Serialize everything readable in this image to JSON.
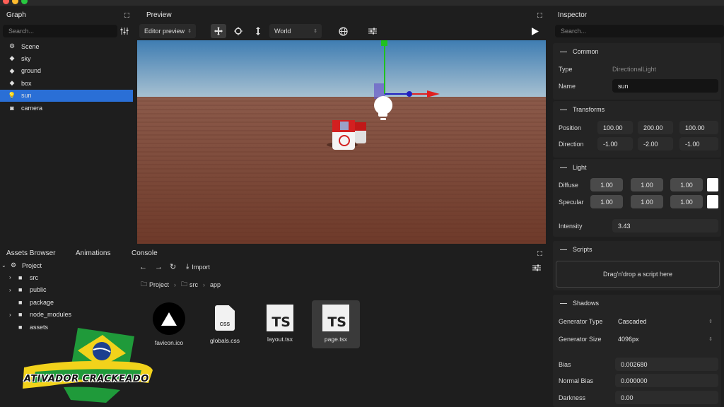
{
  "graph": {
    "title": "Graph",
    "search_placeholder": "Search...",
    "items": [
      {
        "label": "Scene",
        "icon": "scene-icon",
        "glyph": "⚙"
      },
      {
        "label": "sky",
        "icon": "cube-icon",
        "glyph": "◆"
      },
      {
        "label": "ground",
        "icon": "cube-icon",
        "glyph": "◆"
      },
      {
        "label": "box",
        "icon": "cube-icon",
        "glyph": "◆"
      },
      {
        "label": "sun",
        "icon": "lightbulb-icon",
        "glyph": "💡"
      },
      {
        "label": "camera",
        "icon": "camera-icon",
        "glyph": "◙"
      }
    ],
    "selected_index": 4
  },
  "preview": {
    "title": "Preview",
    "mode_select": "Editor preview",
    "space_select": "World"
  },
  "inspector": {
    "title": "Inspector",
    "search_placeholder": "Search...",
    "common": {
      "header": "Common",
      "type_label": "Type",
      "type_value": "DirectionalLight",
      "name_label": "Name",
      "name_value": "sun"
    },
    "transforms": {
      "header": "Transforms",
      "position_label": "Position",
      "position": [
        "100.00",
        "200.00",
        "100.00"
      ],
      "direction_label": "Direction",
      "direction": [
        "-1.00",
        "-2.00",
        "-1.00"
      ]
    },
    "light": {
      "header": "Light",
      "diffuse_label": "Diffuse",
      "diffuse": [
        "1.00",
        "1.00",
        "1.00"
      ],
      "specular_label": "Specular",
      "specular": [
        "1.00",
        "1.00",
        "1.00"
      ],
      "intensity_label": "Intensity",
      "intensity": "3.43"
    },
    "scripts": {
      "header": "Scripts",
      "drop_text": "Drag'n'drop a script here"
    },
    "shadows": {
      "header": "Shadows",
      "generator_type_label": "Generator Type",
      "generator_type": "Cascaded",
      "generator_size_label": "Generator Size",
      "generator_size": "4096px",
      "bias_label": "Bias",
      "bias": "0.002680",
      "normal_bias_label": "Normal Bias",
      "normal_bias": "0.000000",
      "darkness_label": "Darkness",
      "darkness": "0.00"
    }
  },
  "bottom": {
    "tabs": [
      "Assets Browser",
      "Animations",
      "Console"
    ],
    "tree": [
      {
        "label": "Project",
        "expander": true,
        "expanded": true
      },
      {
        "label": "src",
        "expander": true
      },
      {
        "label": "public",
        "expander": true
      },
      {
        "label": "package",
        "expander": false
      },
      {
        "label": "node_modules",
        "expander": true
      },
      {
        "label": "assets",
        "expander": false
      }
    ],
    "import_label": "Import",
    "breadcrumb": [
      "Project",
      "src",
      "app"
    ],
    "assets": [
      {
        "name": "favicon.ico",
        "kind": "triangle-logo"
      },
      {
        "name": "globals.css",
        "kind": "css-file",
        "badge": "CSS"
      },
      {
        "name": "layout.tsx",
        "kind": "ts-file",
        "badge": "TS"
      },
      {
        "name": "page.tsx",
        "kind": "ts-file",
        "badge": "TS"
      }
    ],
    "selected_asset": 3
  },
  "watermark": "ATIVADOR CRACKEADO",
  "colors": {
    "selection": "#2a6fd6",
    "sky_top": "#4a7fae",
    "ground": "#7a4536",
    "axis_x": "#e02020",
    "axis_y": "#20c020",
    "axis_z": "#3030d0"
  }
}
